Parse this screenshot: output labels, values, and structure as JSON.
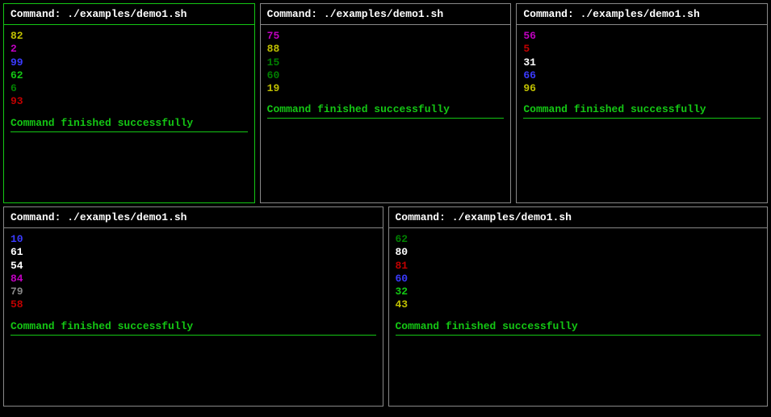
{
  "labels": {
    "command_prefix": "Command: ",
    "status_success": "Command finished successfully"
  },
  "colors": {
    "yellow": "#c0c000",
    "magenta": "#c000c0",
    "blue": "#3a3aff",
    "green": "#14c714",
    "dgreen": "#008000",
    "red": "#c00000",
    "gray": "#888888",
    "white": "#ffffff"
  },
  "panes": [
    {
      "id": "p1",
      "active": true,
      "command": "./examples/demo1.sh",
      "output": [
        {
          "text": "82",
          "color": "yellow"
        },
        {
          "text": "2",
          "color": "magenta"
        },
        {
          "text": "99",
          "color": "blue"
        },
        {
          "text": "62",
          "color": "green"
        },
        {
          "text": "6",
          "color": "dgreen"
        },
        {
          "text": "93",
          "color": "red"
        }
      ],
      "status": "success"
    },
    {
      "id": "p2",
      "active": false,
      "command": "./examples/demo1.sh",
      "output": [
        {
          "text": "75",
          "color": "magenta"
        },
        {
          "text": "88",
          "color": "yellow"
        },
        {
          "text": "15",
          "color": "dgreen"
        },
        {
          "text": "60",
          "color": "dgreen"
        },
        {
          "text": "19",
          "color": "yellow"
        }
      ],
      "status": "success"
    },
    {
      "id": "p3",
      "active": false,
      "command": "./examples/demo1.sh",
      "output": [
        {
          "text": "56",
          "color": "magenta"
        },
        {
          "text": "5",
          "color": "red"
        },
        {
          "text": "31",
          "color": "white"
        },
        {
          "text": "66",
          "color": "blue"
        },
        {
          "text": "96",
          "color": "yellow"
        }
      ],
      "status": "success"
    },
    {
      "id": "p4",
      "active": false,
      "command": "./examples/demo1.sh",
      "output": [
        {
          "text": "10",
          "color": "blue"
        },
        {
          "text": "61",
          "color": "white"
        },
        {
          "text": "54",
          "color": "white"
        },
        {
          "text": "84",
          "color": "magenta"
        },
        {
          "text": "79",
          "color": "gray"
        },
        {
          "text": "58",
          "color": "red"
        }
      ],
      "status": "success"
    },
    {
      "id": "p5",
      "active": false,
      "command": "./examples/demo1.sh",
      "output": [
        {
          "text": "62",
          "color": "dgreen"
        },
        {
          "text": "80",
          "color": "white"
        },
        {
          "text": "81",
          "color": "red"
        },
        {
          "text": "60",
          "color": "blue"
        },
        {
          "text": "32",
          "color": "green"
        },
        {
          "text": "43",
          "color": "yellow"
        }
      ],
      "status": "success"
    }
  ]
}
